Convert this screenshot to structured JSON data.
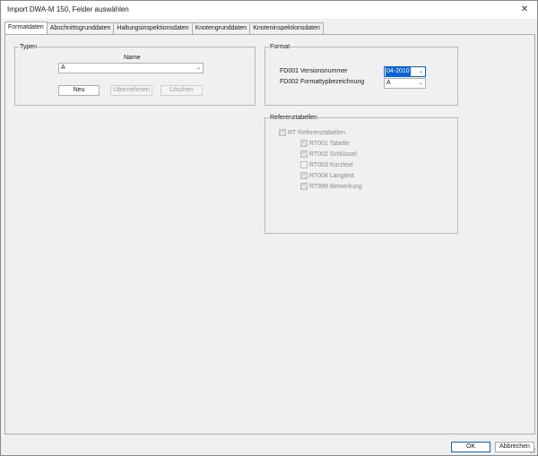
{
  "window": {
    "title": "Import DWA-M 150, Felder auswählen",
    "close_glyph": "✕"
  },
  "tabs": [
    {
      "label": "Formatdaten",
      "active": true
    },
    {
      "label": "Abschnittsgrunddaten",
      "active": false
    },
    {
      "label": "Haltungsinspektionsdaten",
      "active": false
    },
    {
      "label": "Knotengrunddaten",
      "active": false
    },
    {
      "label": "Knoteninspektionsdaten",
      "active": false
    }
  ],
  "typen": {
    "legend": "Typen",
    "name_label": "Name",
    "name_value": "A",
    "buttons": {
      "neu": "Neu",
      "uebernehmen": "Übernehmen",
      "loeschen": "Löschen"
    }
  },
  "format": {
    "legend": "Format",
    "fd001_label": "FD001 Versionsnummer",
    "fd001_value": "04-2010",
    "fd002_label": "FD002 Formattypbezeichnung",
    "fd002_value": "A"
  },
  "referenz": {
    "legend": "Referenztabellen",
    "root": {
      "label": "RT Referenztabellen",
      "checked": true
    },
    "items": [
      {
        "label": "RT001 Tabelle",
        "checked": true
      },
      {
        "label": "RT002 Schlüssel",
        "checked": true
      },
      {
        "label": "RT003 Kurztext",
        "checked": false
      },
      {
        "label": "RT004 Langtext",
        "checked": true
      },
      {
        "label": "RT999 Bemerkung",
        "checked": true
      }
    ]
  },
  "footer": {
    "ok": "OK",
    "cancel": "Abbrechen"
  },
  "icons": {
    "chevron": "chevron-down-icon",
    "close": "close-icon"
  }
}
